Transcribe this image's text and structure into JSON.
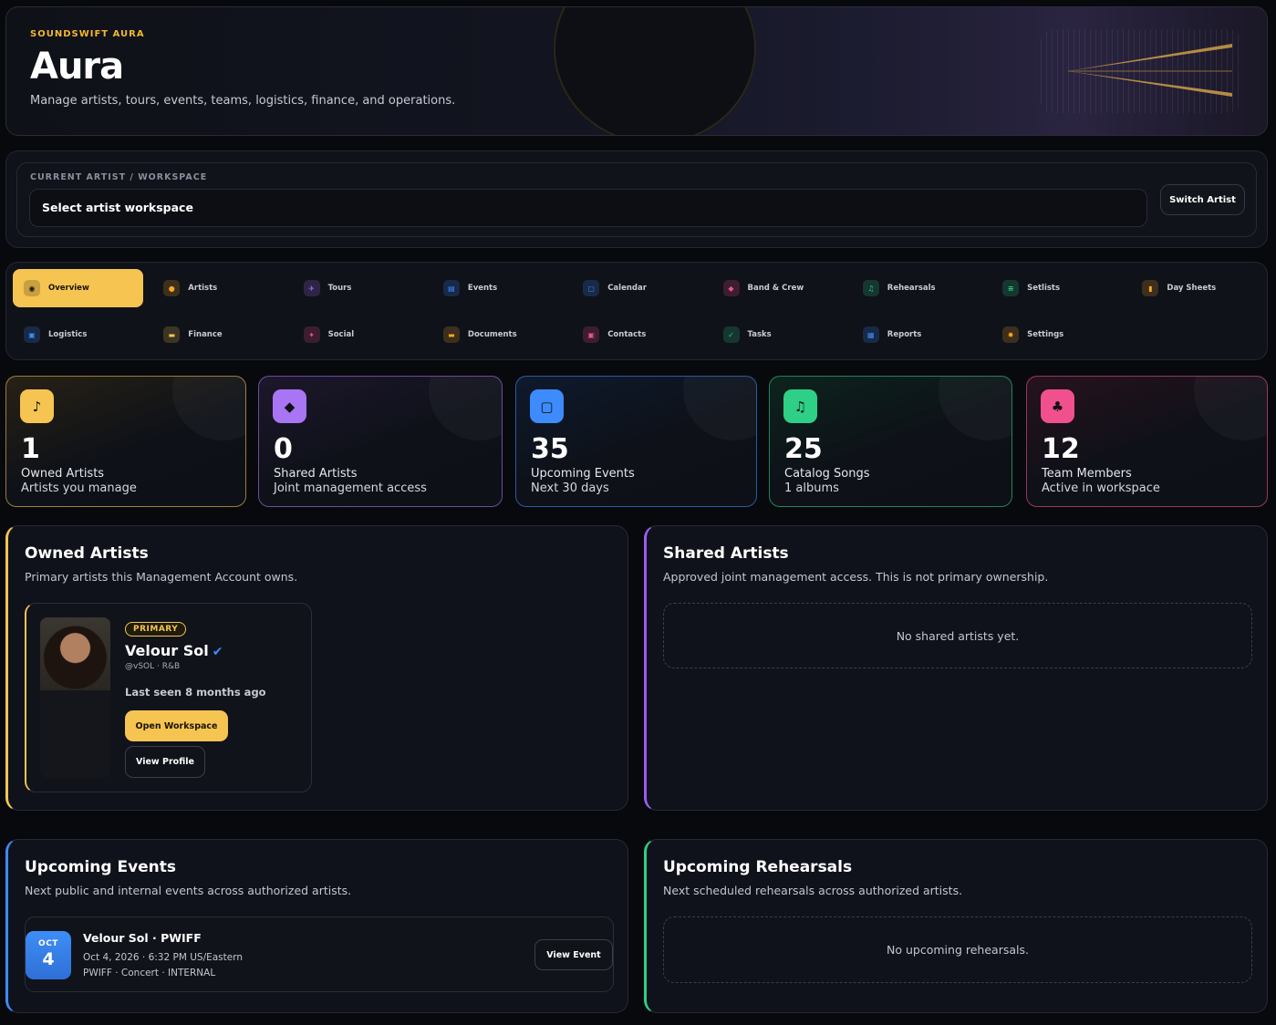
{
  "hero": {
    "eyebrow": "SOUNDSWIFT AURA",
    "title": "Aura",
    "subtitle": "Manage artists, tours, events, teams, logistics, finance, and operations."
  },
  "workspace": {
    "label": "CURRENT ARTIST / WORKSPACE",
    "select_value": "Select artist workspace",
    "switch_label": "Switch Artist"
  },
  "nav": {
    "items": [
      {
        "label": "Overview",
        "icon": "gauge-icon",
        "color": "#f5c451",
        "active": true
      },
      {
        "label": "Artists",
        "icon": "person-icon",
        "color": "#f5a623"
      },
      {
        "label": "Tours",
        "icon": "plane-icon",
        "color": "#a875f5"
      },
      {
        "label": "Events",
        "icon": "ticket-icon",
        "color": "#3d8bfd"
      },
      {
        "label": "Calendar",
        "icon": "calendar-icon",
        "color": "#3d8bfd"
      },
      {
        "label": "Band & Crew",
        "icon": "users-icon",
        "color": "#f0508e"
      },
      {
        "label": "Rehearsals",
        "icon": "music-icon",
        "color": "#2ecf86"
      },
      {
        "label": "Setlists",
        "icon": "list-icon",
        "color": "#2ecf86"
      },
      {
        "label": "Day Sheets",
        "icon": "clipboard-icon",
        "color": "#f5a623"
      },
      {
        "label": "Logistics",
        "icon": "truck-icon",
        "color": "#3d8bfd"
      },
      {
        "label": "Finance",
        "icon": "wallet-icon",
        "color": "#f5c451"
      },
      {
        "label": "Social",
        "icon": "share-icon",
        "color": "#f0508e"
      },
      {
        "label": "Documents",
        "icon": "folder-icon",
        "color": "#f5a623"
      },
      {
        "label": "Contacts",
        "icon": "contact-icon",
        "color": "#f0508e"
      },
      {
        "label": "Tasks",
        "icon": "check-icon",
        "color": "#2ecf86"
      },
      {
        "label": "Reports",
        "icon": "chart-icon",
        "color": "#3d8bfd"
      },
      {
        "label": "Settings",
        "icon": "gear-icon",
        "color": "#f5a623"
      }
    ]
  },
  "stats": [
    {
      "value": "1",
      "label": "Owned Artists",
      "sub": "Artists you manage",
      "icon": "headphones-icon",
      "color": "#f5c451"
    },
    {
      "value": "0",
      "label": "Shared Artists",
      "sub": "Joint management access",
      "icon": "users-icon",
      "color": "#a875f5"
    },
    {
      "value": "35",
      "label": "Upcoming Events",
      "sub": "Next 30 days",
      "icon": "calendar-icon",
      "color": "#3d8bfd"
    },
    {
      "value": "25",
      "label": "Catalog Songs",
      "sub": "1 albums",
      "icon": "music-icon",
      "color": "#2ecf86"
    },
    {
      "value": "12",
      "label": "Team Members",
      "sub": "Active in workspace",
      "icon": "team-icon",
      "color": "#f0508e"
    }
  ],
  "owned": {
    "title": "Owned Artists",
    "subtitle": "Primary artists this Management Account owns.",
    "artist": {
      "badge": "PRIMARY",
      "name": "Velour Sol",
      "handle": "@vSOL · R&B",
      "last_seen": "Last seen 8 months ago",
      "open_label": "Open Workspace",
      "profile_label": "View Profile"
    }
  },
  "shared": {
    "title": "Shared Artists",
    "subtitle": "Approved joint management access. This is not primary ownership.",
    "empty": "No shared artists yet."
  },
  "events": {
    "title": "Upcoming Events",
    "subtitle": "Next public and internal events across authorized artists.",
    "item": {
      "month": "OCT",
      "day": "4",
      "title": "Velour Sol · PWIFF",
      "when": "Oct 4, 2026 · 6:32 PM US/Eastern",
      "meta": "PWIFF · Concert · INTERNAL",
      "button": "View Event"
    }
  },
  "rehearsals": {
    "title": "Upcoming Rehearsals",
    "subtitle": "Next scheduled rehearsals across authorized artists.",
    "empty": "No upcoming rehearsals."
  }
}
